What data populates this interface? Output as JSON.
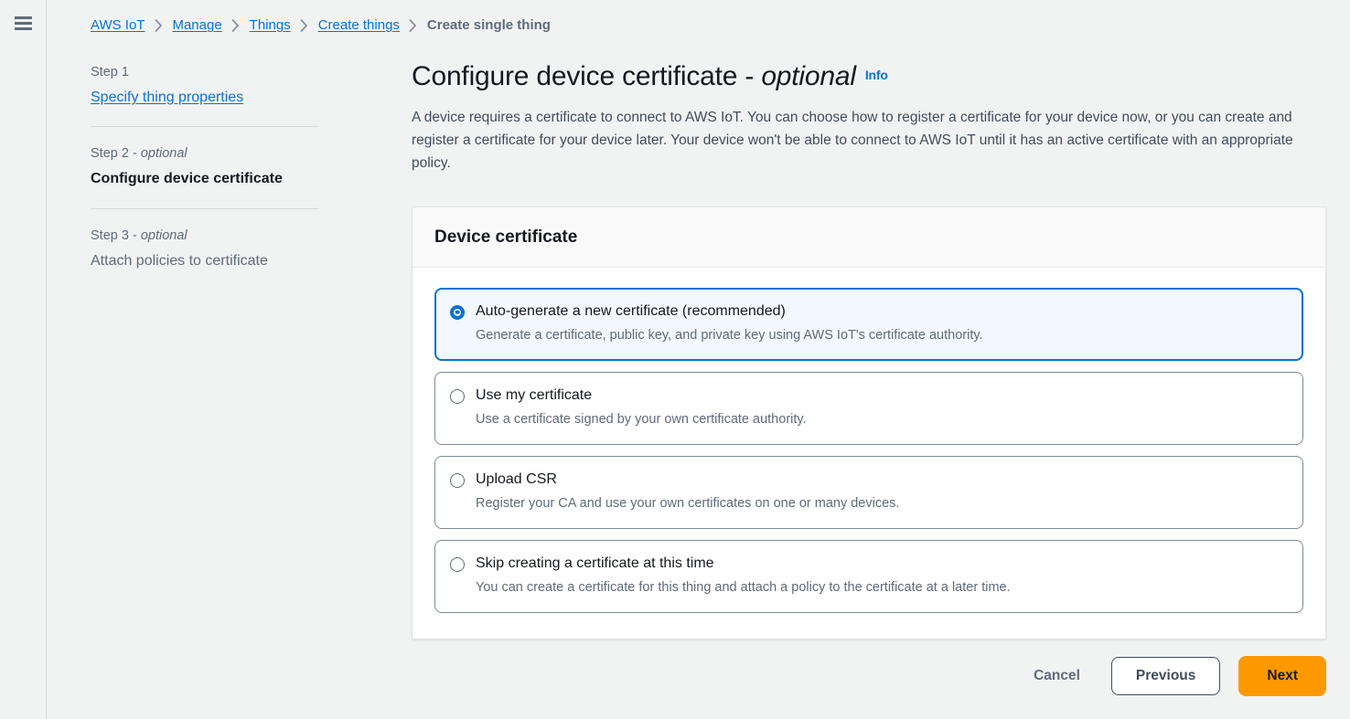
{
  "chrome": {
    "menu_icon": "hamburger-icon"
  },
  "breadcrumb": {
    "items": [
      {
        "label": "AWS IoT",
        "type": "link"
      },
      {
        "label": "Manage",
        "type": "link"
      },
      {
        "label": "Things",
        "type": "link"
      },
      {
        "label": "Create things",
        "type": "link"
      },
      {
        "label": "Create single thing",
        "type": "current"
      }
    ],
    "separator_icon": "chevron-right-icon"
  },
  "steps": [
    {
      "kicker": "Step 1",
      "optional_suffix": "",
      "title": "Specify thing properties",
      "state": "link"
    },
    {
      "kicker": "Step 2 - ",
      "optional_suffix": "optional",
      "title": "Configure device certificate",
      "state": "active"
    },
    {
      "kicker": "Step 3 - ",
      "optional_suffix": "optional",
      "title": "Attach policies to certificate",
      "state": "idle"
    }
  ],
  "header": {
    "title_main": "Configure device certificate - ",
    "title_optional": "optional",
    "info_label": "Info",
    "description": "A device requires a certificate to connect to AWS IoT. You can choose how to register a certificate for your device now, or you can create and register a certificate for your device later. Your device won't be able to connect to AWS IoT until it has an active certificate with an appropriate policy."
  },
  "card": {
    "title": "Device certificate",
    "options": [
      {
        "label": "Auto-generate a new certificate (recommended)",
        "description": "Generate a certificate, public key, and private key using AWS IoT's certificate authority.",
        "selected": true
      },
      {
        "label": "Use my certificate",
        "description": "Use a certificate signed by your own certificate authority.",
        "selected": false
      },
      {
        "label": "Upload CSR",
        "description": "Register your CA and use your own certificates on one or many devices.",
        "selected": false
      },
      {
        "label": "Skip creating a certificate at this time",
        "description": "You can create a certificate for this thing and attach a policy to the certificate at a later time.",
        "selected": false
      }
    ]
  },
  "actions": {
    "cancel_label": "Cancel",
    "previous_label": "Previous",
    "next_label": "Next"
  },
  "colors": {
    "link": "#0972d3",
    "primary_button": "#ff9900",
    "selected_tile_bg": "#f2f8fd",
    "page_bg": "#f1f3f3",
    "text": "#16191f",
    "muted_text": "#5f6b7a"
  }
}
